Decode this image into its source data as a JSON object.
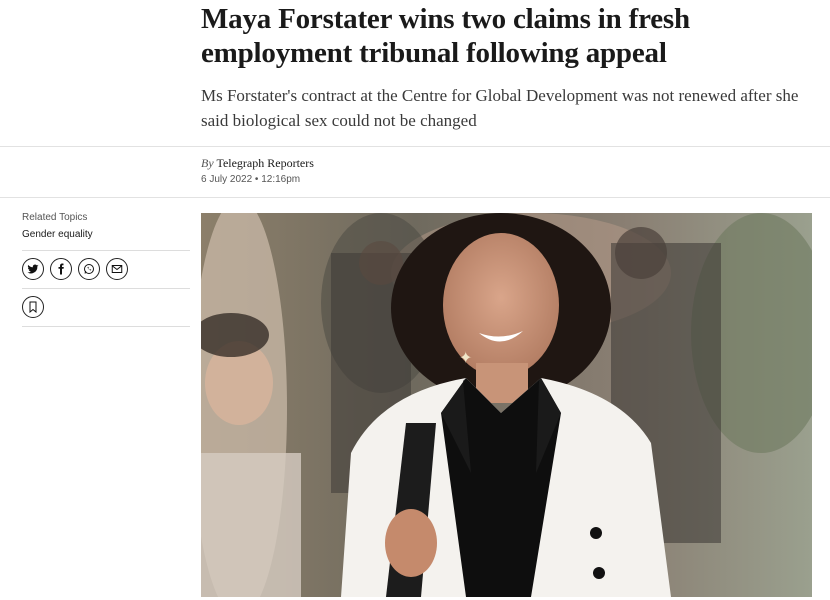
{
  "article": {
    "headline": "Maya Forstater wins two claims in fresh employment tribunal following appeal",
    "standfirst": "Ms Forstater's contract at the Centre for Global Development was not renewed after she said biological sex could not be changed",
    "byline_prefix": "By",
    "author": "Telegraph Reporters",
    "dateline": "6 July 2022 • 12:16pm"
  },
  "sidebar": {
    "related_label": "Related Topics",
    "topics": [
      "Gender equality"
    ],
    "share_icons": [
      "twitter-icon",
      "facebook-icon",
      "whatsapp-icon",
      "email-icon"
    ],
    "save_icon": "bookmark-icon"
  },
  "colors": {
    "text": "#1a1a1a",
    "rule": "#e2e2e2"
  }
}
